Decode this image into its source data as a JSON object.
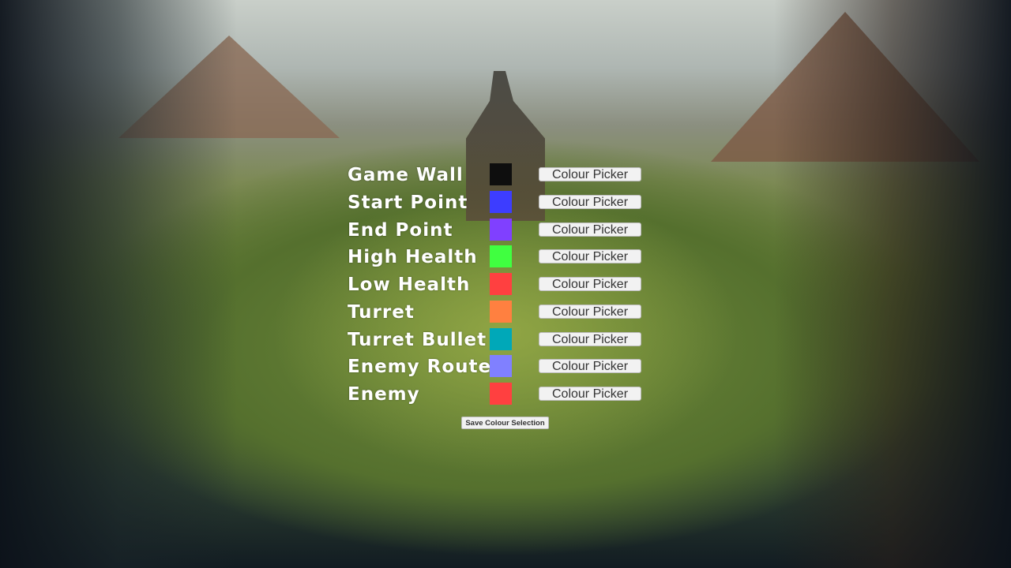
{
  "settings": {
    "rows": [
      {
        "label": "Game Wall",
        "color": "#0e0e0e",
        "button": "Colour Picker"
      },
      {
        "label": "Start Point",
        "color": "#3d3dff",
        "button": "Colour Picker"
      },
      {
        "label": "End Point",
        "color": "#8040ff",
        "button": "Colour Picker"
      },
      {
        "label": "High Health",
        "color": "#40ff40",
        "button": "Colour Picker"
      },
      {
        "label": "Low Health",
        "color": "#ff4040",
        "button": "Colour Picker"
      },
      {
        "label": "Turret",
        "color": "#ff8040",
        "button": "Colour Picker"
      },
      {
        "label": "Turret Bullet",
        "color": "#00a8b8",
        "button": "Colour Picker"
      },
      {
        "label": "Enemy Route",
        "color": "#8080ff",
        "button": "Colour Picker"
      },
      {
        "label": "Enemy",
        "color": "#ff4040",
        "button": "Colour Picker"
      }
    ],
    "save_label": "Save Colour Selection"
  }
}
